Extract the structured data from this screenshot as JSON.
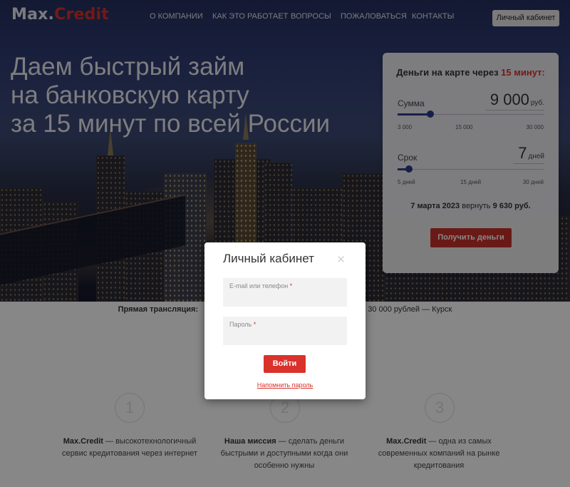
{
  "header": {
    "logo_part1": "Max.",
    "logo_part2": "Credit",
    "nav": [
      "О КОМПАНИИ",
      "КАК ЭТО РАБОТАЕТ",
      "ВОПРОСЫ",
      "ПОЖАЛОВАТЬСЯ",
      "КОНТАКТЫ"
    ],
    "cabinet_button": "Личный кабинет"
  },
  "hero": {
    "title_lines": [
      "Даем быстрый займ",
      "на банковскую карту",
      "за 15 минут по всей России"
    ]
  },
  "calculator": {
    "heading_prefix": "Деньги на карте через",
    "heading_highlight": "15 минут:",
    "amount": {
      "label": "Сумма",
      "value": "9 000",
      "unit": "руб.",
      "ticks": [
        "3 000",
        "15 000",
        "30 000"
      ],
      "min": 3000,
      "max": 30000,
      "current": 9000
    },
    "term": {
      "label": "Срок",
      "value": "7",
      "unit": "дней",
      "ticks": [
        "5 дней",
        "15 дней",
        "30 дней"
      ],
      "min": 5,
      "max": 30,
      "current": 7
    },
    "summary_date": "7 марта 2023",
    "summary_text": "вернуть",
    "summary_amount": "9 630 руб.",
    "submit_button": "Получить деньги"
  },
  "broadcast": {
    "label": "Прямая трансляция:",
    "text_left": "",
    "text_right": "30 000 рублей — Курск"
  },
  "features": [
    {
      "number": "1",
      "bold": "Max.Credit",
      "text": " — высокотехнологичный сервис кредитования через интернет"
    },
    {
      "number": "2",
      "bold": "Наша миссия",
      "text": " — сделать деньги быстрыми и доступными когда они особенно нужны"
    },
    {
      "number": "3",
      "bold": "Max.Credit",
      "text": " — одна из самых современных компаний на рынке кредитования"
    }
  ],
  "modal": {
    "title": "Личный кабинет",
    "close_icon": "×",
    "login_placeholder": "E-mail или телефон",
    "password_placeholder": "Пароль",
    "required_mark": "*",
    "login_button": "Войти",
    "remind_link": "Напомнить пароль"
  },
  "colors": {
    "accent": "#d9322b",
    "slider": "#2d3a8a"
  }
}
